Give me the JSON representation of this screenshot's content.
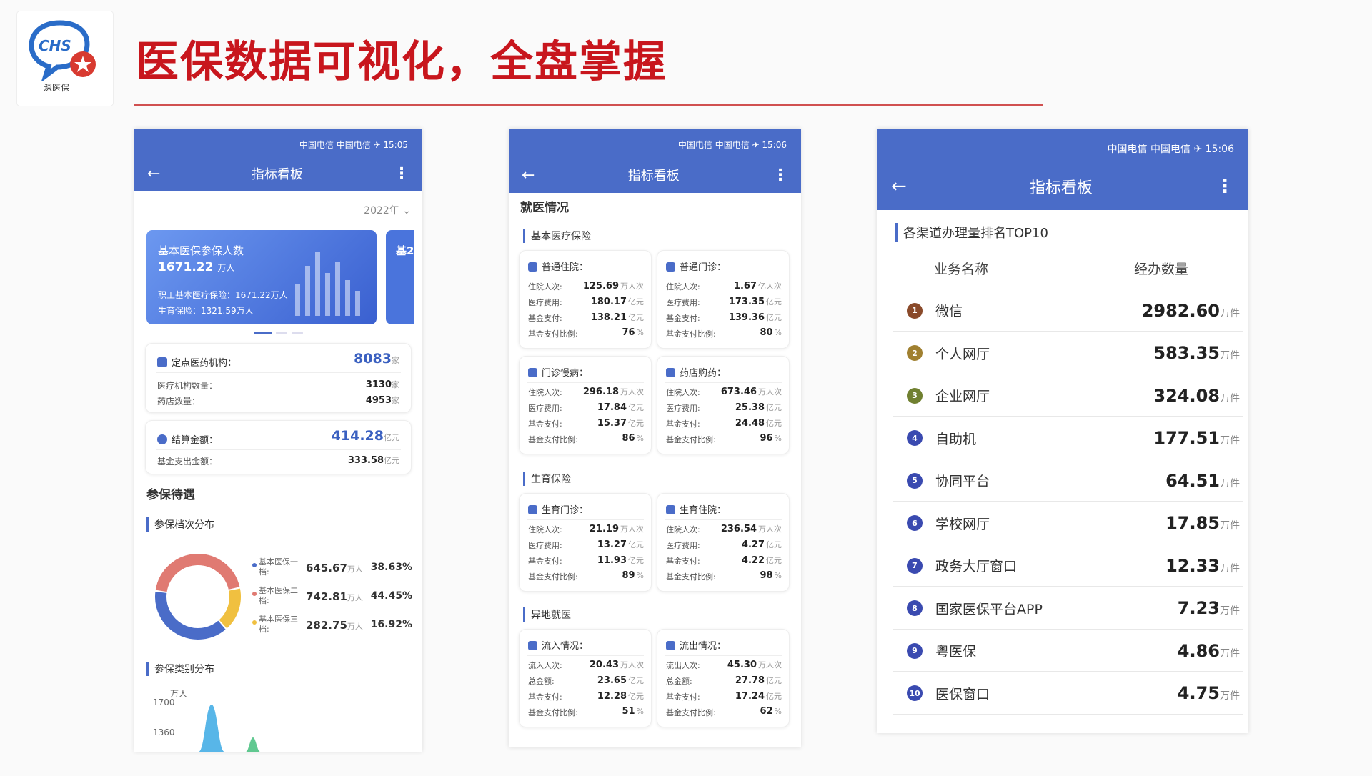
{
  "page": {
    "title": "医保数据可视化，全盘掌握",
    "logo_text": "CHS",
    "logo_caption": "深医保"
  },
  "phone1": {
    "status": "中国电信 中国电信 ✈ 15:05",
    "nav_title": "指标看板",
    "year": "2022年",
    "banner": {
      "title": "基本医保参保人数",
      "value": "1671.22",
      "unit": "万人",
      "line1": "职工基本医疗保险：1671.22万人",
      "line2": "生育保险：1321.59万人",
      "peek": "基2"
    },
    "institutions": {
      "label": "定点医药机构：",
      "value": "8083",
      "unit": "家",
      "rows": [
        {
          "k": "医疗机构数量：",
          "v": "3130",
          "u": "家"
        },
        {
          "k": "药店数量：",
          "v": "4953",
          "u": "家"
        }
      ]
    },
    "settlement": {
      "label": "结算金额：",
      "value": "414.28",
      "unit": "亿元",
      "row": {
        "k": "基金支出金额：",
        "v": "333.58",
        "u": "亿元"
      }
    },
    "section": "参保待遇",
    "dist_title": "参保档次分布",
    "donut": [
      {
        "name": "基本医保一档:",
        "value": "645.67",
        "unit": "万人",
        "pct": "38.63%",
        "color": "#4a6cc8"
      },
      {
        "name": "基本医保二档:",
        "value": "742.81",
        "unit": "万人",
        "pct": "44.45%",
        "color": "#e07a72"
      },
      {
        "name": "基本医保三档:",
        "value": "282.75",
        "unit": "万人",
        "pct": "16.92%",
        "color": "#f0c040"
      }
    ],
    "type_title": "参保类别分布",
    "type_axis": {
      "unit": "万人",
      "ticks": [
        "1700",
        "1360"
      ]
    }
  },
  "phone2": {
    "status": "中国电信 中国电信 ✈ 15:06",
    "nav_title": "指标看板",
    "section": "就医情况",
    "groups": [
      {
        "title": "基本医疗保险",
        "cards": [
          {
            "title": "普通住院：",
            "rows": [
              [
                "住院人次:",
                "125.69",
                "万人次"
              ],
              [
                "医疗费用:",
                "180.17",
                "亿元"
              ],
              [
                "基金支付:",
                "138.21",
                "亿元"
              ],
              [
                "基金支付比例:",
                "76",
                "%"
              ]
            ]
          },
          {
            "title": "普通门诊：",
            "rows": [
              [
                "住院人次:",
                "1.67",
                "亿人次"
              ],
              [
                "医疗费用:",
                "173.35",
                "亿元"
              ],
              [
                "基金支付:",
                "139.36",
                "亿元"
              ],
              [
                "基金支付比例:",
                "80",
                "%"
              ]
            ]
          },
          {
            "title": "门诊慢病：",
            "rows": [
              [
                "住院人次:",
                "296.18",
                "万人次"
              ],
              [
                "医疗费用:",
                "17.84",
                "亿元"
              ],
              [
                "基金支付:",
                "15.37",
                "亿元"
              ],
              [
                "基金支付比例:",
                "86",
                "%"
              ]
            ]
          },
          {
            "title": "药店购药：",
            "rows": [
              [
                "住院人次:",
                "673.46",
                "万人次"
              ],
              [
                "医疗费用:",
                "25.38",
                "亿元"
              ],
              [
                "基金支付:",
                "24.48",
                "亿元"
              ],
              [
                "基金支付比例:",
                "96",
                "%"
              ]
            ]
          }
        ]
      },
      {
        "title": "生育保险",
        "cards": [
          {
            "title": "生育门诊：",
            "rows": [
              [
                "住院人次:",
                "21.19",
                "万人次"
              ],
              [
                "医疗费用:",
                "13.27",
                "亿元"
              ],
              [
                "基金支付:",
                "11.93",
                "亿元"
              ],
              [
                "基金支付比例:",
                "89",
                "%"
              ]
            ]
          },
          {
            "title": "生育住院：",
            "rows": [
              [
                "住院人次:",
                "236.54",
                "万人次"
              ],
              [
                "医疗费用:",
                "4.27",
                "亿元"
              ],
              [
                "基金支付:",
                "4.22",
                "亿元"
              ],
              [
                "基金支付比例:",
                "98",
                "%"
              ]
            ]
          }
        ]
      },
      {
        "title": "异地就医",
        "cards": [
          {
            "title": "流入情况：",
            "rows": [
              [
                "流入人次:",
                "20.43",
                "万人次"
              ],
              [
                "总金额:",
                "23.65",
                "亿元"
              ],
              [
                "基金支付:",
                "12.28",
                "亿元"
              ],
              [
                "基金支付比例:",
                "51",
                "%"
              ]
            ]
          },
          {
            "title": "流出情况：",
            "rows": [
              [
                "流出人次:",
                "45.30",
                "万人次"
              ],
              [
                "总金额:",
                "27.78",
                "亿元"
              ],
              [
                "基金支付:",
                "17.24",
                "亿元"
              ],
              [
                "基金支付比例:",
                "62",
                "%"
              ]
            ]
          }
        ]
      }
    ]
  },
  "phone3": {
    "status": "中国电信 中国电信 ✈ 15:06",
    "nav_title": "指标看板",
    "rank_title": "各渠道办理量排名TOP10",
    "col_name": "业务名称",
    "col_count": "经办数量",
    "unit": "万件",
    "rows": [
      {
        "rank": "1",
        "name": "微信",
        "value": "2982.60"
      },
      {
        "rank": "2",
        "name": "个人网厅",
        "value": "583.35"
      },
      {
        "rank": "3",
        "name": "企业网厅",
        "value": "324.08"
      },
      {
        "rank": "4",
        "name": "自助机",
        "value": "177.51"
      },
      {
        "rank": "5",
        "name": "协同平台",
        "value": "64.51"
      },
      {
        "rank": "6",
        "name": "学校网厅",
        "value": "17.85"
      },
      {
        "rank": "7",
        "name": "政务大厅窗口",
        "value": "12.33"
      },
      {
        "rank": "8",
        "name": "国家医保平台APP",
        "value": "7.23"
      },
      {
        "rank": "9",
        "name": "粤医保",
        "value": "4.86"
      },
      {
        "rank": "10",
        "name": "医保窗口",
        "value": "4.75"
      }
    ],
    "badge_colors": [
      "#8a4a2a",
      "#a08030",
      "#708030",
      "#3a4ab0",
      "#3a4ab0",
      "#3a4ab0",
      "#3a4ab0",
      "#3a4ab0",
      "#3a4ab0",
      "#3a4ab0"
    ]
  }
}
